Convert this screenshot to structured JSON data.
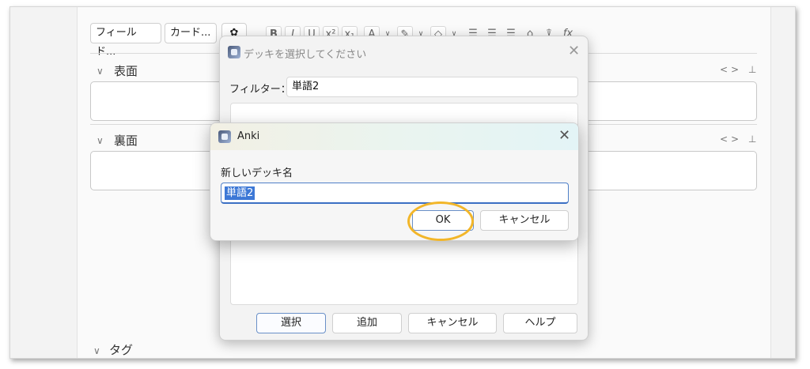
{
  "toolbar": {
    "fields_button": "フィールド...",
    "cards_button": "カード...",
    "gear_icon": "✿",
    "bold": "B",
    "italic": "I",
    "underline": "U",
    "superscript": "x²",
    "subscript": "x₁",
    "text_color": "A",
    "highlight": "✎",
    "eraser": "◇",
    "bullet_list": "☰",
    "numbered_list": "☰",
    "align": "☰",
    "attach": "⌂",
    "record": "⍒",
    "function": "fx",
    "dropdown": "∨"
  },
  "fields": {
    "front_label": "表面",
    "back_label": "裏面",
    "tags_label": "タグ",
    "tools": "<> ⊥"
  },
  "deck_dialog": {
    "title": "デッキを選択してください",
    "filter_label": "フィルター：",
    "filter_value": "単語2",
    "buttons": {
      "select": "選択",
      "add": "追加",
      "cancel": "キャンセル",
      "help": "ヘルプ"
    }
  },
  "new_deck_dialog": {
    "title": "Anki",
    "label": "新しいデッキ名",
    "value": "単語2",
    "ok": "OK",
    "cancel": "キャンセル",
    "close": "✕"
  },
  "colors": {
    "accent": "#3d78d6",
    "highlight_ring": "#f2b629"
  }
}
